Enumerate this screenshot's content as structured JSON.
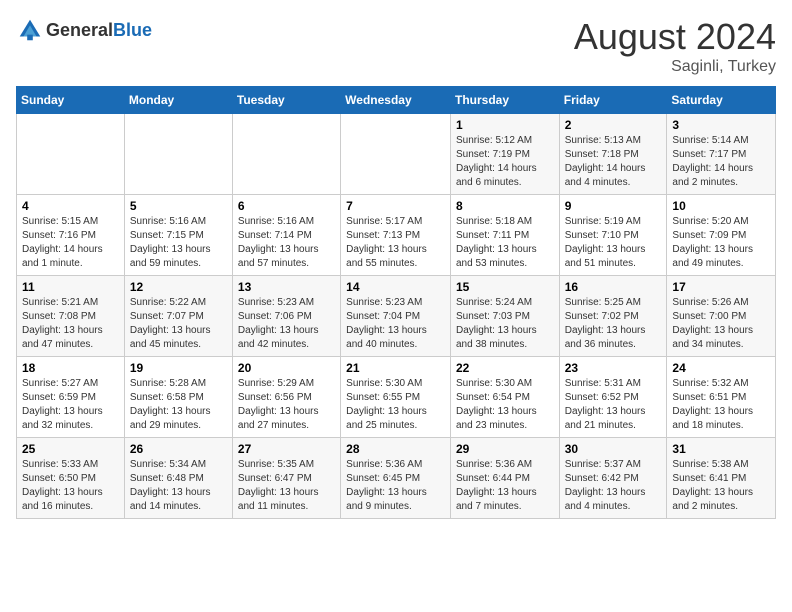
{
  "header": {
    "logo_general": "General",
    "logo_blue": "Blue",
    "month_year": "August 2024",
    "location": "Saginli, Turkey"
  },
  "weekdays": [
    "Sunday",
    "Monday",
    "Tuesday",
    "Wednesday",
    "Thursday",
    "Friday",
    "Saturday"
  ],
  "weeks": [
    [
      {
        "day": "",
        "info": ""
      },
      {
        "day": "",
        "info": ""
      },
      {
        "day": "",
        "info": ""
      },
      {
        "day": "",
        "info": ""
      },
      {
        "day": "1",
        "info": "Sunrise: 5:12 AM\nSunset: 7:19 PM\nDaylight: 14 hours\nand 6 minutes."
      },
      {
        "day": "2",
        "info": "Sunrise: 5:13 AM\nSunset: 7:18 PM\nDaylight: 14 hours\nand 4 minutes."
      },
      {
        "day": "3",
        "info": "Sunrise: 5:14 AM\nSunset: 7:17 PM\nDaylight: 14 hours\nand 2 minutes."
      }
    ],
    [
      {
        "day": "4",
        "info": "Sunrise: 5:15 AM\nSunset: 7:16 PM\nDaylight: 14 hours\nand 1 minute."
      },
      {
        "day": "5",
        "info": "Sunrise: 5:16 AM\nSunset: 7:15 PM\nDaylight: 13 hours\nand 59 minutes."
      },
      {
        "day": "6",
        "info": "Sunrise: 5:16 AM\nSunset: 7:14 PM\nDaylight: 13 hours\nand 57 minutes."
      },
      {
        "day": "7",
        "info": "Sunrise: 5:17 AM\nSunset: 7:13 PM\nDaylight: 13 hours\nand 55 minutes."
      },
      {
        "day": "8",
        "info": "Sunrise: 5:18 AM\nSunset: 7:11 PM\nDaylight: 13 hours\nand 53 minutes."
      },
      {
        "day": "9",
        "info": "Sunrise: 5:19 AM\nSunset: 7:10 PM\nDaylight: 13 hours\nand 51 minutes."
      },
      {
        "day": "10",
        "info": "Sunrise: 5:20 AM\nSunset: 7:09 PM\nDaylight: 13 hours\nand 49 minutes."
      }
    ],
    [
      {
        "day": "11",
        "info": "Sunrise: 5:21 AM\nSunset: 7:08 PM\nDaylight: 13 hours\nand 47 minutes."
      },
      {
        "day": "12",
        "info": "Sunrise: 5:22 AM\nSunset: 7:07 PM\nDaylight: 13 hours\nand 45 minutes."
      },
      {
        "day": "13",
        "info": "Sunrise: 5:23 AM\nSunset: 7:06 PM\nDaylight: 13 hours\nand 42 minutes."
      },
      {
        "day": "14",
        "info": "Sunrise: 5:23 AM\nSunset: 7:04 PM\nDaylight: 13 hours\nand 40 minutes."
      },
      {
        "day": "15",
        "info": "Sunrise: 5:24 AM\nSunset: 7:03 PM\nDaylight: 13 hours\nand 38 minutes."
      },
      {
        "day": "16",
        "info": "Sunrise: 5:25 AM\nSunset: 7:02 PM\nDaylight: 13 hours\nand 36 minutes."
      },
      {
        "day": "17",
        "info": "Sunrise: 5:26 AM\nSunset: 7:00 PM\nDaylight: 13 hours\nand 34 minutes."
      }
    ],
    [
      {
        "day": "18",
        "info": "Sunrise: 5:27 AM\nSunset: 6:59 PM\nDaylight: 13 hours\nand 32 minutes."
      },
      {
        "day": "19",
        "info": "Sunrise: 5:28 AM\nSunset: 6:58 PM\nDaylight: 13 hours\nand 29 minutes."
      },
      {
        "day": "20",
        "info": "Sunrise: 5:29 AM\nSunset: 6:56 PM\nDaylight: 13 hours\nand 27 minutes."
      },
      {
        "day": "21",
        "info": "Sunrise: 5:30 AM\nSunset: 6:55 PM\nDaylight: 13 hours\nand 25 minutes."
      },
      {
        "day": "22",
        "info": "Sunrise: 5:30 AM\nSunset: 6:54 PM\nDaylight: 13 hours\nand 23 minutes."
      },
      {
        "day": "23",
        "info": "Sunrise: 5:31 AM\nSunset: 6:52 PM\nDaylight: 13 hours\nand 21 minutes."
      },
      {
        "day": "24",
        "info": "Sunrise: 5:32 AM\nSunset: 6:51 PM\nDaylight: 13 hours\nand 18 minutes."
      }
    ],
    [
      {
        "day": "25",
        "info": "Sunrise: 5:33 AM\nSunset: 6:50 PM\nDaylight: 13 hours\nand 16 minutes."
      },
      {
        "day": "26",
        "info": "Sunrise: 5:34 AM\nSunset: 6:48 PM\nDaylight: 13 hours\nand 14 minutes."
      },
      {
        "day": "27",
        "info": "Sunrise: 5:35 AM\nSunset: 6:47 PM\nDaylight: 13 hours\nand 11 minutes."
      },
      {
        "day": "28",
        "info": "Sunrise: 5:36 AM\nSunset: 6:45 PM\nDaylight: 13 hours\nand 9 minutes."
      },
      {
        "day": "29",
        "info": "Sunrise: 5:36 AM\nSunset: 6:44 PM\nDaylight: 13 hours\nand 7 minutes."
      },
      {
        "day": "30",
        "info": "Sunrise: 5:37 AM\nSunset: 6:42 PM\nDaylight: 13 hours\nand 4 minutes."
      },
      {
        "day": "31",
        "info": "Sunrise: 5:38 AM\nSunset: 6:41 PM\nDaylight: 13 hours\nand 2 minutes."
      }
    ]
  ]
}
